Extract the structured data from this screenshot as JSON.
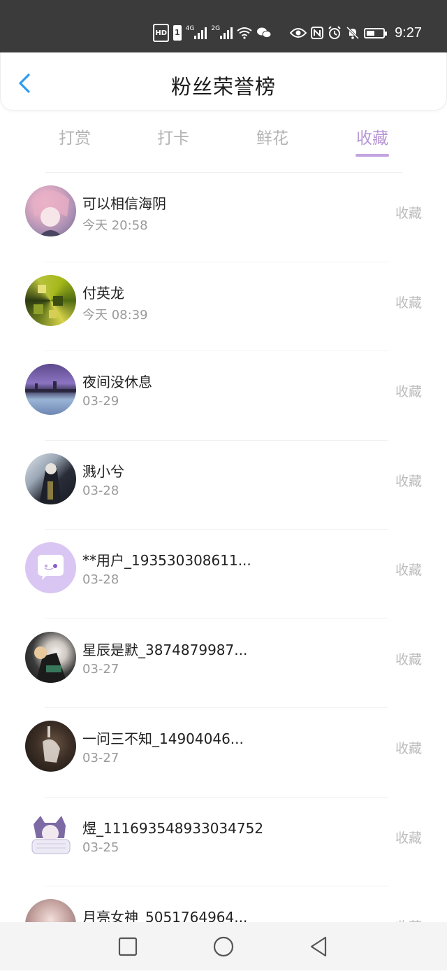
{
  "status_bar": {
    "hd": "HD",
    "sim": "1",
    "net1": "4G",
    "net2": "2G",
    "time": "9:27",
    "icons": [
      "hd-icon",
      "signal-4g-icon",
      "signal-2g-icon",
      "wifi-icon",
      "wechat-icon",
      "eye-icon",
      "nfc-icon",
      "alarm-icon",
      "mute-icon",
      "battery-icon"
    ],
    "battery_level": 0.5
  },
  "header": {
    "title": "粉丝荣誉榜",
    "back_icon": "chevron-left-icon",
    "accent": "#2e9cf0"
  },
  "tabs": [
    {
      "label": "打赏",
      "active": false
    },
    {
      "label": "打卡",
      "active": false
    },
    {
      "label": "鲜花",
      "active": false
    },
    {
      "label": "收藏",
      "active": true
    }
  ],
  "colors": {
    "tab_active": "#b795d6",
    "tab_inactive": "#b3b3b3",
    "action": "#bcbcbc"
  },
  "list": [
    {
      "name": "可以相信海阴",
      "time": "今天 20:58",
      "action": "收藏"
    },
    {
      "name": "付英龙",
      "time": "今天 08:39",
      "action": "收藏"
    },
    {
      "name": "夜间没休息",
      "time": "03-29",
      "action": "收藏"
    },
    {
      "name": "溅小兮",
      "time": "03-28",
      "action": "收藏"
    },
    {
      "name": "**用户_193530308611...",
      "time": "03-28",
      "action": "收藏"
    },
    {
      "name": "星辰是默_3874879987...",
      "time": "03-27",
      "action": "收藏"
    },
    {
      "name": "一问三不知_14904046...",
      "time": "03-27",
      "action": "收藏"
    },
    {
      "name": "煜_111693548933034752",
      "time": "03-25",
      "action": "收藏"
    },
    {
      "name": "月亮女神_5051764964...",
      "time": "",
      "action": "收藏"
    }
  ],
  "nav_bar": {
    "buttons": [
      "recent-apps-icon",
      "home-icon",
      "back-icon"
    ]
  }
}
